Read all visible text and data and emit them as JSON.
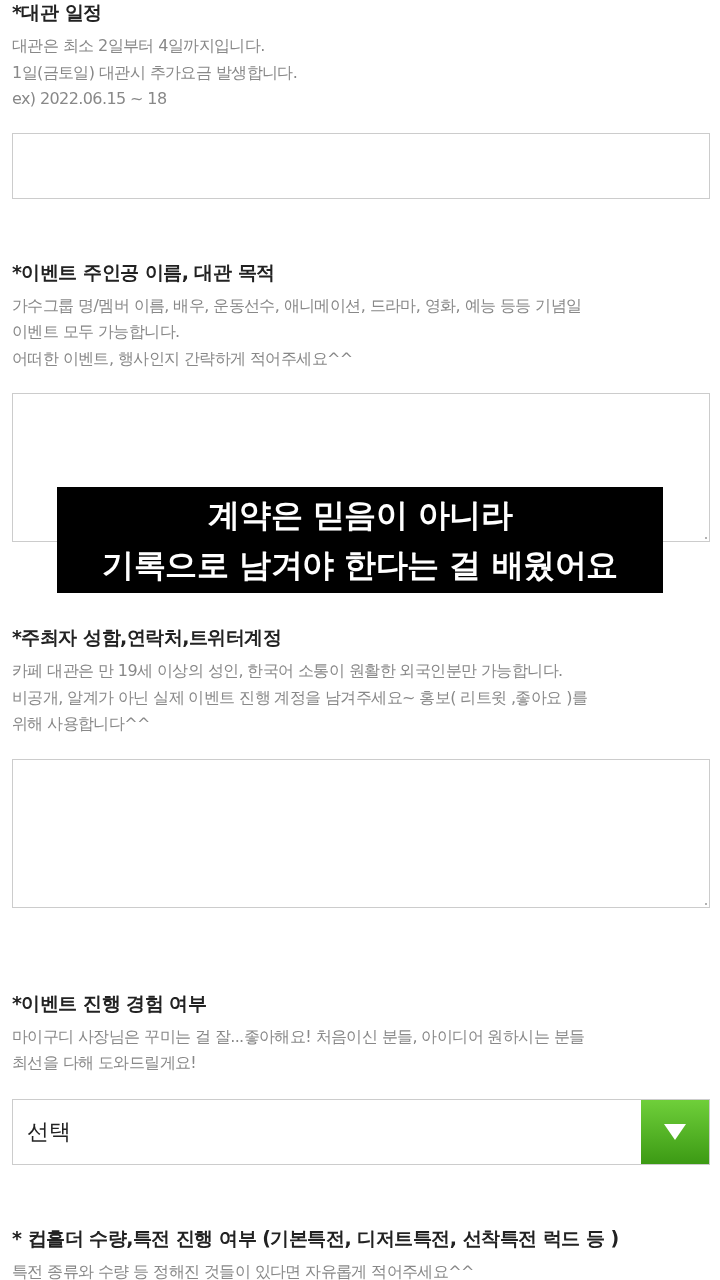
{
  "sections": [
    {
      "title": "*대관 일정",
      "description": [
        "대관은 최소 2일부터 4일까지입니다.",
        "1일(금토일) 대관시 추가요금 발생합니다.",
        "ex) 2022.06.15 ~ 18"
      ],
      "field": {
        "kind": "input"
      }
    },
    {
      "title": "*이벤트 주인공 이름, 대관 목적",
      "description": [
        "가수그룹 명/멤버 이름, 배우, 운동선수, 애니메이션, 드라마, 영화, 예능 등등 기념일",
        "이벤트 모두 가능합니다.",
        "어떠한 이벤트, 행사인지 간략하게 적어주세요^^"
      ],
      "field": {
        "kind": "textarea"
      }
    },
    {
      "title": "*주최자 성함,연락처,트위터계정",
      "description": [
        "카페 대관은 만 19세 이상의 성인, 한국어 소통이 원활한 외국인분만 가능합니다.",
        "비공개, 알계가 아닌 실제 이벤트 진행 계정을 남겨주세요~ 홍보( 리트윗 ,좋아요 )를",
        "위해 사용합니다^^"
      ],
      "field": {
        "kind": "textarea"
      }
    },
    {
      "title": "*이벤트 진행 경험 여부",
      "description": [
        "마이구디 사장님은 꾸미는 걸 잘...좋아해요! 처음이신 분들, 아이디어 원하시는 분들",
        "최선을 다해 도와드릴게요!"
      ],
      "field": {
        "kind": "select",
        "value": "선택"
      }
    },
    {
      "title": "* 컵홀더 수량,특전 진행 여부 (기본특전, 디저트특전, 선착특전 럭드 등 )",
      "description": [
        "특전 종류와 수량 등 정해진 것들이 있다면 자유롭게 적어주세요^^"
      ]
    }
  ],
  "caption": [
    "계약은 믿음이 아니라",
    "기록으로 남겨야 한다는 걸 배웠어요"
  ]
}
